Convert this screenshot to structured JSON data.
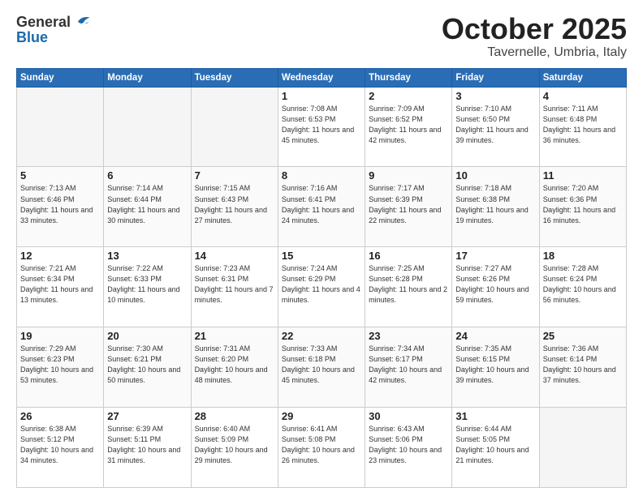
{
  "header": {
    "logo_general": "General",
    "logo_blue": "Blue",
    "month_title": "October 2025",
    "location": "Tavernelle, Umbria, Italy"
  },
  "days_of_week": [
    "Sunday",
    "Monday",
    "Tuesday",
    "Wednesday",
    "Thursday",
    "Friday",
    "Saturday"
  ],
  "weeks": [
    [
      {
        "day": "",
        "empty": true
      },
      {
        "day": "",
        "empty": true
      },
      {
        "day": "",
        "empty": true
      },
      {
        "day": "1",
        "sunrise": "7:08 AM",
        "sunset": "6:53 PM",
        "daylight": "11 hours and 45 minutes."
      },
      {
        "day": "2",
        "sunrise": "7:09 AM",
        "sunset": "6:52 PM",
        "daylight": "11 hours and 42 minutes."
      },
      {
        "day": "3",
        "sunrise": "7:10 AM",
        "sunset": "6:50 PM",
        "daylight": "11 hours and 39 minutes."
      },
      {
        "day": "4",
        "sunrise": "7:11 AM",
        "sunset": "6:48 PM",
        "daylight": "11 hours and 36 minutes."
      }
    ],
    [
      {
        "day": "5",
        "sunrise": "7:13 AM",
        "sunset": "6:46 PM",
        "daylight": "11 hours and 33 minutes."
      },
      {
        "day": "6",
        "sunrise": "7:14 AM",
        "sunset": "6:44 PM",
        "daylight": "11 hours and 30 minutes."
      },
      {
        "day": "7",
        "sunrise": "7:15 AM",
        "sunset": "6:43 PM",
        "daylight": "11 hours and 27 minutes."
      },
      {
        "day": "8",
        "sunrise": "7:16 AM",
        "sunset": "6:41 PM",
        "daylight": "11 hours and 24 minutes."
      },
      {
        "day": "9",
        "sunrise": "7:17 AM",
        "sunset": "6:39 PM",
        "daylight": "11 hours and 22 minutes."
      },
      {
        "day": "10",
        "sunrise": "7:18 AM",
        "sunset": "6:38 PM",
        "daylight": "11 hours and 19 minutes."
      },
      {
        "day": "11",
        "sunrise": "7:20 AM",
        "sunset": "6:36 PM",
        "daylight": "11 hours and 16 minutes."
      }
    ],
    [
      {
        "day": "12",
        "sunrise": "7:21 AM",
        "sunset": "6:34 PM",
        "daylight": "11 hours and 13 minutes."
      },
      {
        "day": "13",
        "sunrise": "7:22 AM",
        "sunset": "6:33 PM",
        "daylight": "11 hours and 10 minutes."
      },
      {
        "day": "14",
        "sunrise": "7:23 AM",
        "sunset": "6:31 PM",
        "daylight": "11 hours and 7 minutes."
      },
      {
        "day": "15",
        "sunrise": "7:24 AM",
        "sunset": "6:29 PM",
        "daylight": "11 hours and 4 minutes."
      },
      {
        "day": "16",
        "sunrise": "7:25 AM",
        "sunset": "6:28 PM",
        "daylight": "11 hours and 2 minutes."
      },
      {
        "day": "17",
        "sunrise": "7:27 AM",
        "sunset": "6:26 PM",
        "daylight": "10 hours and 59 minutes."
      },
      {
        "day": "18",
        "sunrise": "7:28 AM",
        "sunset": "6:24 PM",
        "daylight": "10 hours and 56 minutes."
      }
    ],
    [
      {
        "day": "19",
        "sunrise": "7:29 AM",
        "sunset": "6:23 PM",
        "daylight": "10 hours and 53 minutes."
      },
      {
        "day": "20",
        "sunrise": "7:30 AM",
        "sunset": "6:21 PM",
        "daylight": "10 hours and 50 minutes."
      },
      {
        "day": "21",
        "sunrise": "7:31 AM",
        "sunset": "6:20 PM",
        "daylight": "10 hours and 48 minutes."
      },
      {
        "day": "22",
        "sunrise": "7:33 AM",
        "sunset": "6:18 PM",
        "daylight": "10 hours and 45 minutes."
      },
      {
        "day": "23",
        "sunrise": "7:34 AM",
        "sunset": "6:17 PM",
        "daylight": "10 hours and 42 minutes."
      },
      {
        "day": "24",
        "sunrise": "7:35 AM",
        "sunset": "6:15 PM",
        "daylight": "10 hours and 39 minutes."
      },
      {
        "day": "25",
        "sunrise": "7:36 AM",
        "sunset": "6:14 PM",
        "daylight": "10 hours and 37 minutes."
      }
    ],
    [
      {
        "day": "26",
        "sunrise": "6:38 AM",
        "sunset": "5:12 PM",
        "daylight": "10 hours and 34 minutes."
      },
      {
        "day": "27",
        "sunrise": "6:39 AM",
        "sunset": "5:11 PM",
        "daylight": "10 hours and 31 minutes."
      },
      {
        "day": "28",
        "sunrise": "6:40 AM",
        "sunset": "5:09 PM",
        "daylight": "10 hours and 29 minutes."
      },
      {
        "day": "29",
        "sunrise": "6:41 AM",
        "sunset": "5:08 PM",
        "daylight": "10 hours and 26 minutes."
      },
      {
        "day": "30",
        "sunrise": "6:43 AM",
        "sunset": "5:06 PM",
        "daylight": "10 hours and 23 minutes."
      },
      {
        "day": "31",
        "sunrise": "6:44 AM",
        "sunset": "5:05 PM",
        "daylight": "10 hours and 21 minutes."
      },
      {
        "day": "",
        "empty": true
      }
    ]
  ]
}
